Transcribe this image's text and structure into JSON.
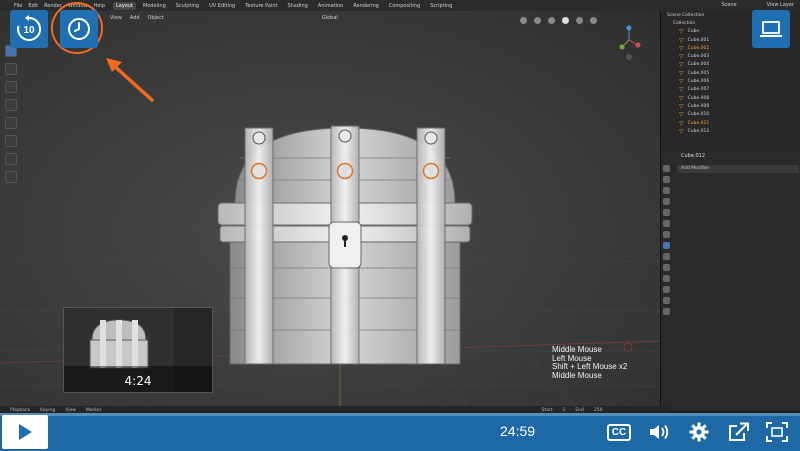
{
  "blender": {
    "menu": [
      "File",
      "Edit",
      "Render",
      "Window",
      "Help"
    ],
    "workspaces": [
      "Layout",
      "Modeling",
      "Sculpting",
      "UV Editing",
      "Texture Paint",
      "Shading",
      "Animation",
      "Rendering",
      "Compositing",
      "Scripting"
    ],
    "active_workspace": "Layout",
    "scene_label": "Scene",
    "view_layer_label": "View Layer",
    "viewport_menu": [
      "View",
      "Add",
      "Object"
    ],
    "transform_orientation": "Global",
    "outliner": {
      "root": "Scene Collection",
      "collection": "Collection",
      "items": [
        "Cube",
        "Cube.001",
        "Cube.002",
        "Cube.003",
        "Cube.004",
        "Cube.005",
        "Cube.006",
        "Cube.007",
        "Cube.008",
        "Cube.009",
        "Cube.010",
        "Cube.011",
        "Cube.012"
      ],
      "selected": [
        "Cube.002",
        "Cube.011"
      ]
    },
    "properties": {
      "object_name": "Cube.012",
      "add_modifier": "Add Modifier"
    },
    "timeline_menu": [
      "Playback",
      "Keying",
      "View",
      "Marker"
    ],
    "timeline_right": [
      "Start",
      "1",
      "End",
      "250"
    ],
    "key_overlay": [
      "Middle Mouse",
      "Left Mouse",
      "Shift + Left Mouse x2",
      "Middle Mouse"
    ]
  },
  "pip": {
    "time": "4:24"
  },
  "player": {
    "replay_seconds": "10",
    "duration": "24:59",
    "progress_fraction": 0.0,
    "cc_label": "CC",
    "accent_color": "#1f6fb2",
    "highlight_color": "#f26a21"
  },
  "icons": {
    "replay": "replay-10-icon",
    "history": "clock-icon",
    "device": "laptop-icon",
    "play": "play-icon",
    "cc": "closed-captions-icon",
    "volume": "volume-icon",
    "settings": "gear-icon",
    "share": "share-icon",
    "fullscreen": "fullscreen-icon"
  }
}
